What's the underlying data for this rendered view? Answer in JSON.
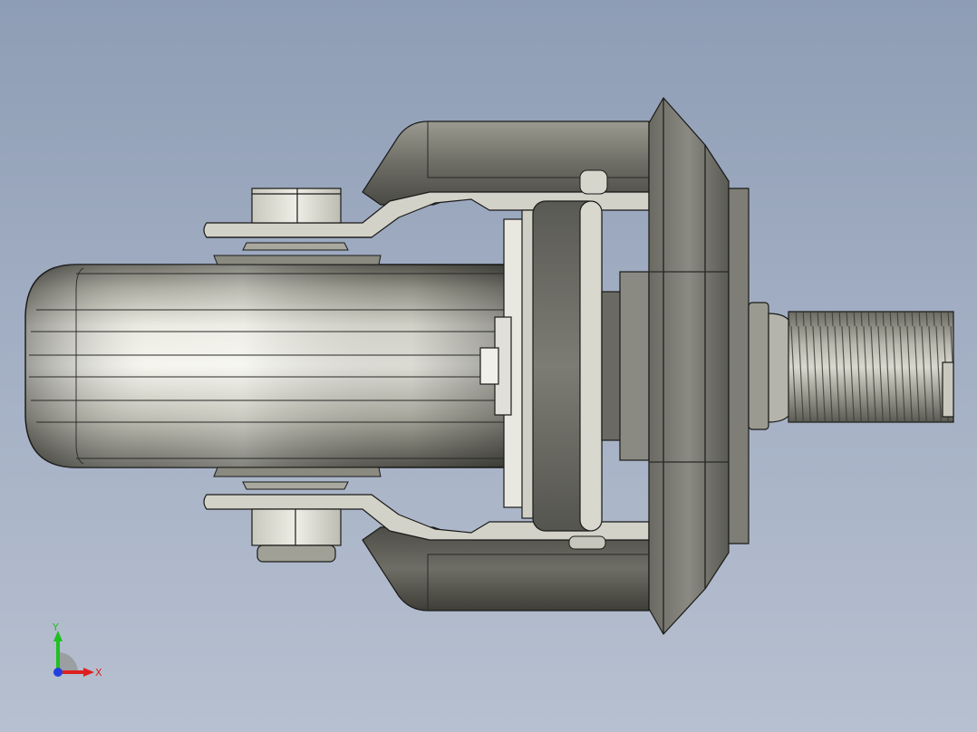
{
  "viewport": {
    "background_top": "#8e9db5",
    "background_bottom": "#b7c0d0",
    "model": "caster-wheel-assembly"
  },
  "triad": {
    "x_label": "X",
    "y_label": "Y",
    "x_color": "#e02020",
    "y_color": "#20c020",
    "z_color": "#2040e0"
  }
}
